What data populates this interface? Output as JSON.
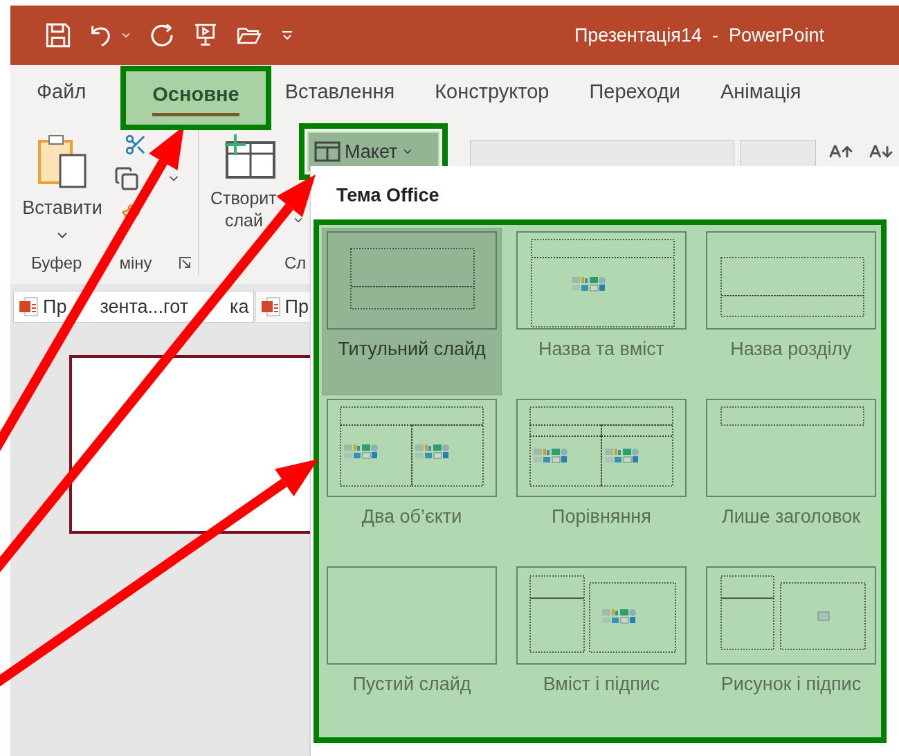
{
  "window": {
    "title": "Презентація14  -  PowerPoint"
  },
  "tabs": [
    {
      "label": "Файл",
      "selected": false
    },
    {
      "label": "Основне",
      "selected": true
    },
    {
      "label": "Вставлення",
      "selected": false
    },
    {
      "label": "Конструктор",
      "selected": false
    },
    {
      "label": "Переходи",
      "selected": false
    },
    {
      "label": "Анімація",
      "selected": false
    }
  ],
  "ribbon": {
    "paste": "Вставити",
    "new_slide": [
      "Створит",
      "слай"
    ],
    "layout_button": "Макет",
    "groups": [
      [
        "Буфер",
        "міну"
      ],
      [
        "Сл"
      ]
    ]
  },
  "document_tabs": [
    {
      "parts": [
        "Пр",
        "зента...гот",
        "ка"
      ],
      "selected": true
    },
    {
      "parts": [
        "Пр"
      ],
      "selected": false
    }
  ],
  "layout_menu": {
    "heading": "Тема Office",
    "layouts": [
      {
        "label": "Титульний слайд",
        "kind": "title",
        "selected": true
      },
      {
        "label": "Назва та вміст",
        "kind": "title-content",
        "selected": false
      },
      {
        "label": "Назва розділу",
        "kind": "section",
        "selected": false
      },
      {
        "label": "Два об’єкти",
        "kind": "two-content",
        "selected": false
      },
      {
        "label": "Порівняння",
        "kind": "comparison",
        "selected": false
      },
      {
        "label": "Лише заголовок",
        "kind": "title-only",
        "selected": false
      },
      {
        "label": "Пустий слайд",
        "kind": "blank",
        "selected": false
      },
      {
        "label": "Вміст і підпис",
        "kind": "content-caption",
        "selected": false
      },
      {
        "label": "Рисунок і підпис",
        "kind": "picture-caption",
        "selected": false
      }
    ]
  }
}
